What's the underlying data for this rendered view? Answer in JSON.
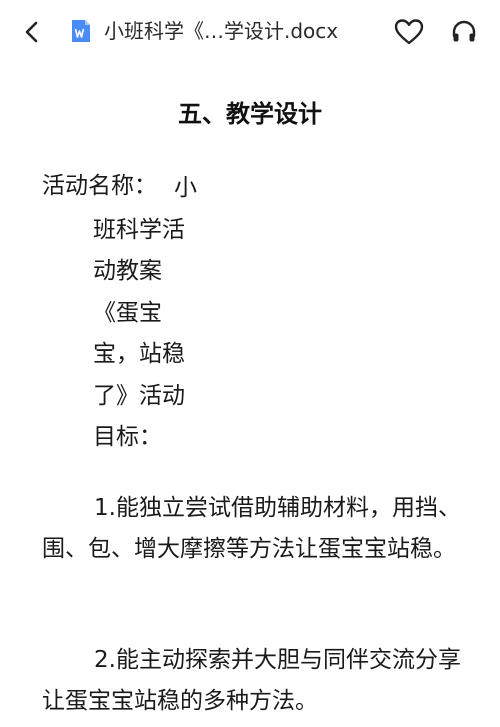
{
  "header": {
    "title": "小班科学《…学设计.docx",
    "back_icon": "chevron-left-icon",
    "doc_icon": "word-document-icon",
    "favorite_icon": "heart-outline-icon",
    "listen_icon": "headphones-icon",
    "doc_icon_color": "#4a8cf7"
  },
  "document": {
    "heading": "五、教学设计",
    "activity_label": "活动名称：",
    "activity_name_lines": [
      "小",
      "班科学活",
      "动教案",
      "《蛋宝",
      "宝，站稳",
      "了》活动",
      "目标："
    ],
    "goals": [
      "1.能独立尝试借助辅助材料，用挡、围、包、增大摩擦等方法让蛋宝宝站稳。",
      "2.能主动探索并大胆与同伴交流分享让蛋宝宝站稳的多种方法。"
    ]
  }
}
